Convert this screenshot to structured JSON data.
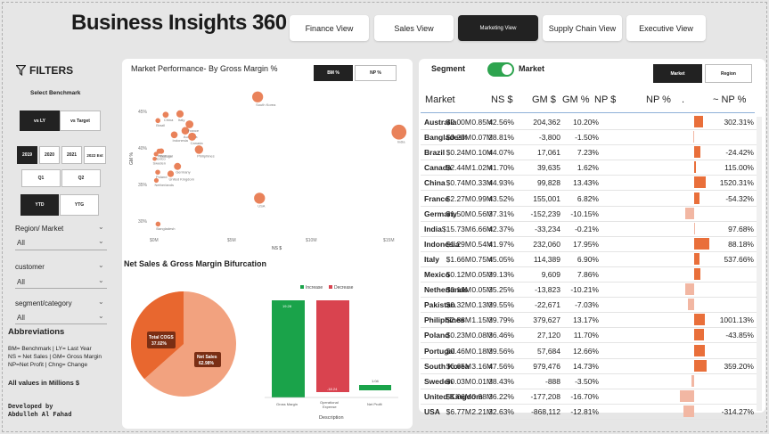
{
  "app": {
    "title": "Business Insights 360"
  },
  "nav": {
    "finance": "Finance View",
    "sales": "Sales View",
    "marketing": "Marketing View",
    "supply": "Supply Chain View",
    "executive": "Executive View"
  },
  "filters": {
    "heading": "FILTERS",
    "benchmark_label": "Select Benchmark",
    "bench_ly": "vs LY",
    "bench_target": "vs Target",
    "years": [
      "2019",
      "2020",
      "2021",
      "2022 Est"
    ],
    "quarters": [
      "Q1",
      "Q2"
    ],
    "ytd": "YTD",
    "ytg": "YTG",
    "region_label": "Region/ Market",
    "region_value": "All",
    "customer_label": "customer",
    "customer_value": "All",
    "segment_label": "segment/category",
    "segment_value": "All",
    "abbr_title": "Abbreviations",
    "abbr_line1": "BM= Benchmark  | LY= Last Year",
    "abbr_line2": "NS = Net Sales  | GM= Gross Margin",
    "abbr_line3": "NP=Net Profit | Chng= Change",
    "values_note": "All values in Millions $",
    "dev_line1": "Developed by",
    "dev_line2": "Abdulleh Al Fahad"
  },
  "scatter": {
    "title": "Market Performance- By Gross Margin %",
    "btn_bm": "BM %",
    "btn_np": "NP %",
    "xlabel": "NS $",
    "ylabel": "GM %",
    "y_ticks": [
      "45%",
      "40%",
      "35%",
      "30%"
    ],
    "x_ticks": [
      "$0M",
      "$5M",
      "$10M",
      "$15M"
    ],
    "color": "#e9825a"
  },
  "waterfall": {
    "title": "Net Sales & Gross Margin Bifurcation",
    "legend_increase": "Increase",
    "legend_decrease": "Decrease",
    "xlabel": "Description",
    "pie_cogs_label": "Total COGS",
    "pie_cogs_value": "37.02%",
    "pie_ns_label": "Net Sales",
    "pie_ns_value": "62.98%",
    "increase_color": "#1aa34a",
    "decrease_color": "#d9434f"
  },
  "segment_panel": {
    "segment_label": "Segment",
    "market_label": "Market",
    "btn_market": "Market",
    "btn_region": "Region"
  },
  "table": {
    "headers": [
      "Market",
      "NS $",
      "GM $",
      "GM %",
      "NP $",
      "NP %",
      ".",
      "~ NP %"
    ],
    "rows": [
      {
        "market": "Australia",
        "ns": "$2.00M",
        "gm": "0.85M",
        "gmp": "42.56%",
        "np": "204,362",
        "npp": "10.20%",
        "chg": "302.31%",
        "bar": 0.4
      },
      {
        "market": "Bangladesh",
        "ns": "$0.25M",
        "gm": "0.07M",
        "gmp": "28.81%",
        "np": "-3,800",
        "npp": "-1.50%",
        "chg": "",
        "bar": -0.06
      },
      {
        "market": "Brazil",
        "ns": "$0.24M",
        "gm": "0.10M",
        "gmp": "44.07%",
        "np": "17,061",
        "npp": "7.23%",
        "chg": "-24.42%",
        "bar": 0.28
      },
      {
        "market": "Canada",
        "ns": "$2.44M",
        "gm": "1.02M",
        "gmp": "41.70%",
        "np": "39,635",
        "npp": "1.62%",
        "chg": "115.00%",
        "bar": 0.07
      },
      {
        "market": "China",
        "ns": "$0.74M",
        "gm": "0.33M",
        "gmp": "44.93%",
        "np": "99,828",
        "npp": "13.43%",
        "chg": "1520.31%",
        "bar": 0.53
      },
      {
        "market": "France",
        "ns": "$2.27M",
        "gm": "0.99M",
        "gmp": "43.52%",
        "np": "155,001",
        "npp": "6.82%",
        "chg": "-54.32%",
        "bar": 0.27
      },
      {
        "market": "Germany",
        "ns": "$1.50M",
        "gm": "0.56M",
        "gmp": "37.31%",
        "np": "-152,239",
        "npp": "-10.15%",
        "chg": "",
        "bar": -0.4
      },
      {
        "market": "India",
        "ns": "$15.73M",
        "gm": "6.66M",
        "gmp": "42.37%",
        "np": "-33,234",
        "npp": "-0.21%",
        "chg": "97.68%",
        "bar": -0.01
      },
      {
        "market": "Indonesia",
        "ns": "$1.29M",
        "gm": "0.54M",
        "gmp": "41.97%",
        "np": "232,060",
        "npp": "17.95%",
        "chg": "88.18%",
        "bar": 0.71
      },
      {
        "market": "Italy",
        "ns": "$1.66M",
        "gm": "0.75M",
        "gmp": "45.05%",
        "np": "114,389",
        "npp": "6.90%",
        "chg": "537.66%",
        "bar": 0.27
      },
      {
        "market": "Mexico",
        "ns": "$0.12M",
        "gm": "0.05M",
        "gmp": "39.13%",
        "np": "9,609",
        "npp": "7.86%",
        "chg": "",
        "bar": 0.31
      },
      {
        "market": "Netherlands",
        "ns": "$0.14M",
        "gm": "0.05M",
        "gmp": "35.25%",
        "np": "-13,823",
        "npp": "-10.21%",
        "chg": "",
        "bar": -0.4
      },
      {
        "market": "Pakistan",
        "ns": "$0.32M",
        "gm": "0.13M",
        "gmp": "39.55%",
        "np": "-22,671",
        "npp": "-7.03%",
        "chg": "",
        "bar": -0.28
      },
      {
        "market": "Philiphines",
        "ns": "$2.88M",
        "gm": "1.15M",
        "gmp": "39.79%",
        "np": "379,627",
        "npp": "13.17%",
        "chg": "1001.13%",
        "bar": 0.52
      },
      {
        "market": "Poland",
        "ns": "$0.23M",
        "gm": "0.08M",
        "gmp": "36.46%",
        "np": "27,120",
        "npp": "11.70%",
        "chg": "-43.85%",
        "bar": 0.46
      },
      {
        "market": "Portugal",
        "ns": "$0.46M",
        "gm": "0.18M",
        "gmp": "39.56%",
        "np": "57,684",
        "npp": "12.66%",
        "chg": "",
        "bar": 0.5
      },
      {
        "market": "South Korea",
        "ns": "$6.65M",
        "gm": "3.16M",
        "gmp": "47.56%",
        "np": "979,476",
        "npp": "14.73%",
        "chg": "359.20%",
        "bar": 0.58
      },
      {
        "market": "Sweden",
        "ns": "$0.03M",
        "gm": "0.01M",
        "gmp": "38.43%",
        "np": "-888",
        "npp": "-3.50%",
        "chg": "",
        "bar": -0.14
      },
      {
        "market": "United Kingdom",
        "ns": "$1.06M",
        "gm": "0.38M",
        "gmp": "36.22%",
        "np": "-177,208",
        "npp": "-16.70%",
        "chg": "",
        "bar": -0.66
      },
      {
        "market": "USA",
        "ns": "$6.77M",
        "gm": "2.21M",
        "gmp": "32.63%",
        "np": "-868,112",
        "npp": "-12.81%",
        "chg": "-314.27%",
        "bar": -0.51
      }
    ]
  }
}
